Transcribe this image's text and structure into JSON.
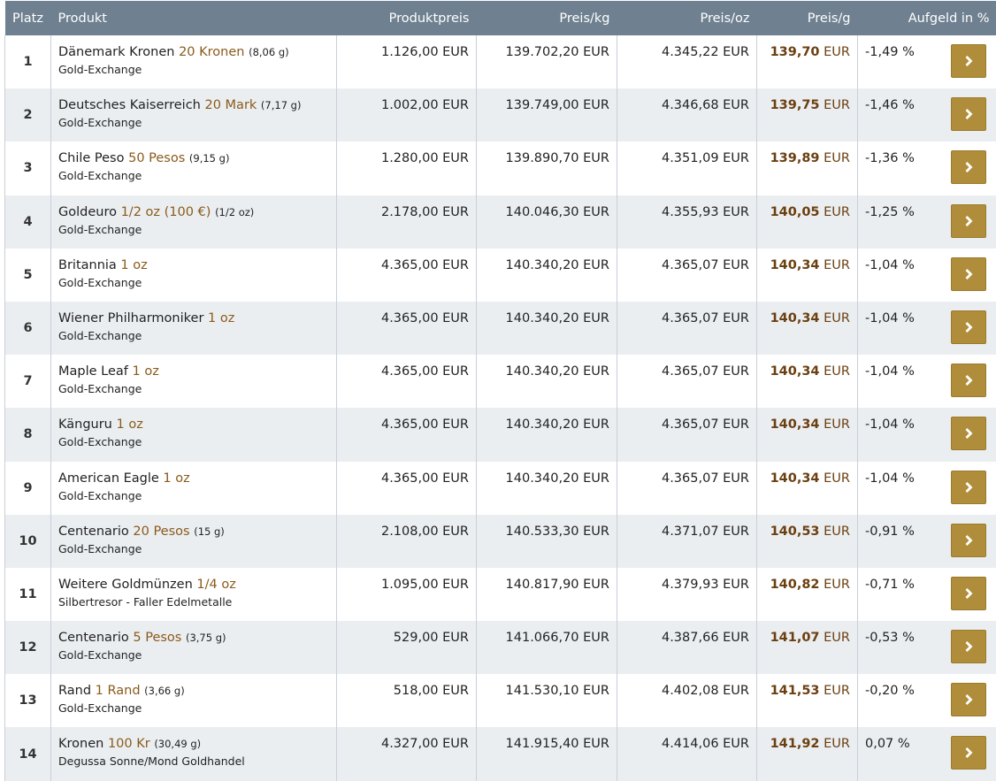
{
  "headers": {
    "platz": "Platz",
    "produkt": "Produkt",
    "produktpreis": "Produktpreis",
    "preis_kg": "Preis/kg",
    "preis_oz": "Preis/oz",
    "preis_g": "Preis/g",
    "aufgeld": "Aufgeld in %"
  },
  "currency": "EUR",
  "rows": [
    {
      "platz": "1",
      "name": "Dänemark Kronen",
      "unit": "20 Kronen",
      "weight": "(8,06 g)",
      "dealer": "Gold-Exchange",
      "price": "1.126,00 EUR",
      "kg": "139.702,20 EUR",
      "oz": "4.345,22 EUR",
      "g": "139,70",
      "aufgeld": "-1,49 %"
    },
    {
      "platz": "2",
      "name": "Deutsches Kaiserreich",
      "unit": "20 Mark",
      "weight": "(7,17 g)",
      "dealer": "Gold-Exchange",
      "price": "1.002,00 EUR",
      "kg": "139.749,00 EUR",
      "oz": "4.346,68 EUR",
      "g": "139,75",
      "aufgeld": "-1,46 %"
    },
    {
      "platz": "3",
      "name": "Chile Peso",
      "unit": "50 Pesos",
      "weight": "(9,15 g)",
      "dealer": "Gold-Exchange",
      "price": "1.280,00 EUR",
      "kg": "139.890,70 EUR",
      "oz": "4.351,09 EUR",
      "g": "139,89",
      "aufgeld": "-1,36 %"
    },
    {
      "platz": "4",
      "name": "Goldeuro",
      "unit": "1/2 oz (100 €)",
      "weight": "(1/2 oz)",
      "dealer": "Gold-Exchange",
      "price": "2.178,00 EUR",
      "kg": "140.046,30 EUR",
      "oz": "4.355,93 EUR",
      "g": "140,05",
      "aufgeld": "-1,25 %"
    },
    {
      "platz": "5",
      "name": "Britannia",
      "unit": "1 oz",
      "weight": "",
      "dealer": "Gold-Exchange",
      "price": "4.365,00 EUR",
      "kg": "140.340,20 EUR",
      "oz": "4.365,07 EUR",
      "g": "140,34",
      "aufgeld": "-1,04 %"
    },
    {
      "platz": "6",
      "name": "Wiener Philharmoniker",
      "unit": "1 oz",
      "weight": "",
      "dealer": "Gold-Exchange",
      "price": "4.365,00 EUR",
      "kg": "140.340,20 EUR",
      "oz": "4.365,07 EUR",
      "g": "140,34",
      "aufgeld": "-1,04 %"
    },
    {
      "platz": "7",
      "name": "Maple Leaf",
      "unit": "1 oz",
      "weight": "",
      "dealer": "Gold-Exchange",
      "price": "4.365,00 EUR",
      "kg": "140.340,20 EUR",
      "oz": "4.365,07 EUR",
      "g": "140,34",
      "aufgeld": "-1,04 %"
    },
    {
      "platz": "8",
      "name": "Känguru",
      "unit": "1 oz",
      "weight": "",
      "dealer": "Gold-Exchange",
      "price": "4.365,00 EUR",
      "kg": "140.340,20 EUR",
      "oz": "4.365,07 EUR",
      "g": "140,34",
      "aufgeld": "-1,04 %"
    },
    {
      "platz": "9",
      "name": "American Eagle",
      "unit": "1 oz",
      "weight": "",
      "dealer": "Gold-Exchange",
      "price": "4.365,00 EUR",
      "kg": "140.340,20 EUR",
      "oz": "4.365,07 EUR",
      "g": "140,34",
      "aufgeld": "-1,04 %"
    },
    {
      "platz": "10",
      "name": "Centenario",
      "unit": "20 Pesos",
      "weight": "(15 g)",
      "dealer": "Gold-Exchange",
      "price": "2.108,00 EUR",
      "kg": "140.533,30 EUR",
      "oz": "4.371,07 EUR",
      "g": "140,53",
      "aufgeld": "-0,91 %"
    },
    {
      "platz": "11",
      "name": "Weitere Goldmünzen",
      "unit": "1/4 oz",
      "weight": "",
      "dealer": "Silbertresor - Faller Edelmetalle",
      "price": "1.095,00 EUR",
      "kg": "140.817,90 EUR",
      "oz": "4.379,93 EUR",
      "g": "140,82",
      "aufgeld": "-0,71 %"
    },
    {
      "platz": "12",
      "name": "Centenario",
      "unit": "5 Pesos",
      "weight": "(3,75 g)",
      "dealer": "Gold-Exchange",
      "price": "529,00 EUR",
      "kg": "141.066,70 EUR",
      "oz": "4.387,66 EUR",
      "g": "141,07",
      "aufgeld": "-0,53 %"
    },
    {
      "platz": "13",
      "name": "Rand",
      "unit": "1 Rand",
      "weight": "(3,66 g)",
      "dealer": "Gold-Exchange",
      "price": "518,00 EUR",
      "kg": "141.530,10 EUR",
      "oz": "4.402,08 EUR",
      "g": "141,53",
      "aufgeld": "-0,20 %"
    },
    {
      "platz": "14",
      "name": "Kronen",
      "unit": "100 Kr",
      "weight": "(30,49 g)",
      "dealer": "Degussa Sonne/Mond Goldhandel",
      "price": "4.327,00 EUR",
      "kg": "141.915,40 EUR",
      "oz": "4.414,06 EUR",
      "g": "141,92",
      "aufgeld": "0,07 %"
    }
  ]
}
